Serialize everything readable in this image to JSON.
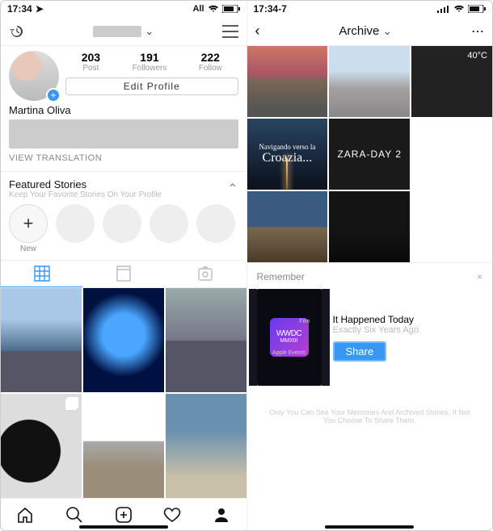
{
  "left": {
    "status_time": "17:34",
    "status_net": "All",
    "header_username": "",
    "stats": {
      "posts_n": "203",
      "posts_l": "Post",
      "followers_n": "191",
      "followers_l": "Followers",
      "following_n": "222",
      "following_l": "Follow"
    },
    "edit_profile": "Edit Profile",
    "display_name": "Martina Oliva",
    "view_translation": "VIEW TRANSLATION",
    "featured_title": "Featured Stories",
    "featured_sub": "Keep Your Favorite Stories On Your Profile",
    "highlight_new": "New"
  },
  "right": {
    "status_time": "17:34-7",
    "archive_title": "Archive",
    "tiles": {
      "temp": "40°C",
      "croatia_l1": "Navigando verso la",
      "croatia_l2": "Croazia...",
      "zara": "ZARA-DAY 2"
    },
    "remember": {
      "heading": "Remember",
      "card_top": "Film",
      "card_mid": "WWDC",
      "card_year": "MMXIII",
      "card_sub": "Apple Events",
      "title": "It Happened Today",
      "subtitle": "Exactly Six Years Ago.",
      "share": "Share",
      "footnote": "Only You Can See Your Memories And Archived Stories, If Not You Choose To Share Them."
    }
  }
}
